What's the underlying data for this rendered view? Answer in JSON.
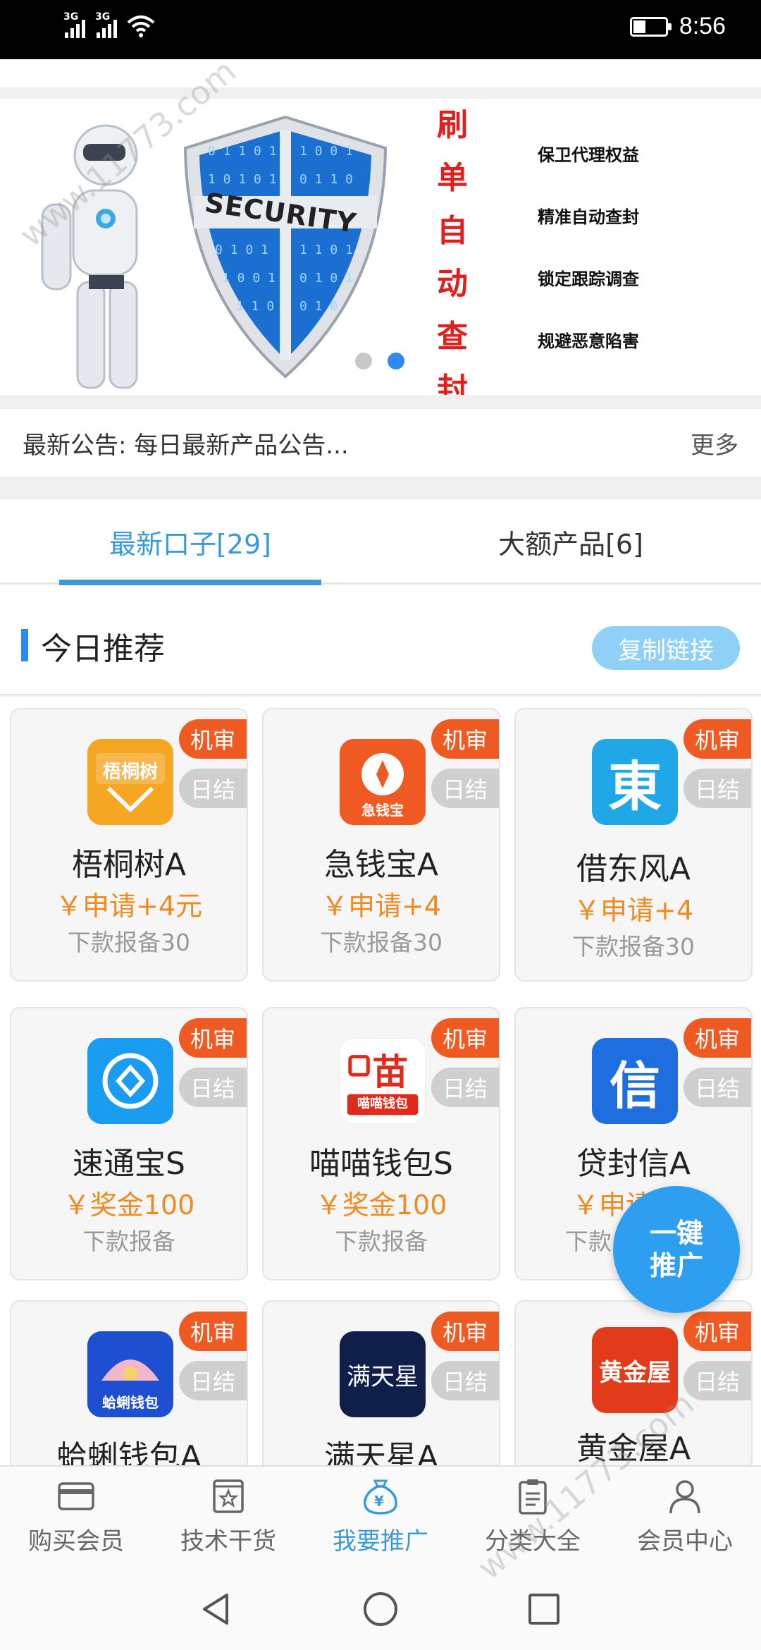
{
  "status_bar": {
    "network_1": "3G",
    "network_2": "3G",
    "time": "8:56",
    "battery_level": 0.4
  },
  "banner": {
    "shield_text": "SECURITY",
    "title_chars": [
      "刷",
      "单",
      "自",
      "动",
      "查",
      "封"
    ],
    "features": [
      "保卫代理权益",
      "精准自动查封",
      "锁定跟踪调查",
      "规避恶意陷害"
    ],
    "dots_active": 1
  },
  "notice": {
    "text": "最新公告: 每日最新产品公告...",
    "more": "更多"
  },
  "tabs": [
    {
      "label": "最新口子[29]",
      "active": true
    },
    {
      "label": "大额产品[6]",
      "active": false
    }
  ],
  "section": {
    "title": "今日推荐",
    "copy_button": "复制链接"
  },
  "cards": [
    {
      "name": "梧桐树A",
      "price": "￥申请+4元",
      "desc": "下款报备30",
      "badge1": "机审",
      "badge2": "日结",
      "logo_text": "梧桐树",
      "logo_color": "#f59a1e"
    },
    {
      "name": "急钱宝A",
      "price": "￥申请+4",
      "desc": "下款报备30",
      "badge1": "机审",
      "badge2": "日结",
      "logo_text": "急钱宝",
      "logo_color": "#ef5a22"
    },
    {
      "name": "借东风A",
      "price": "￥申请+4",
      "desc": "下款报备30",
      "badge1": "机审",
      "badge2": "日结",
      "logo_text": "東",
      "logo_color": "#1fa7e8"
    },
    {
      "name": "速通宝S",
      "price": "￥奖金100",
      "desc": "下款报备",
      "badge1": "机审",
      "badge2": "日结",
      "logo_text": "",
      "logo_color": "#1a9df0"
    },
    {
      "name": "喵喵钱包S",
      "price": "￥奖金100",
      "desc": "下款报备",
      "badge1": "机审",
      "badge2": "日结",
      "logo_text": "喵喵钱包",
      "logo_color": "#ffffff"
    },
    {
      "name": "贷封信A",
      "price": "￥申请",
      "desc": "下款",
      "badge1": "机审",
      "badge2": "日结",
      "logo_text": "信",
      "logo_color": "#1f6ee0"
    },
    {
      "name": "蛤蜊钱包A",
      "price": "",
      "desc": "",
      "badge1": "机审",
      "badge2": "日结",
      "logo_text": "蛤蜊钱包",
      "logo_color": "#1e4fd1"
    },
    {
      "name": "满天星A",
      "price": "",
      "desc": "",
      "badge1": "机审",
      "badge2": "日结",
      "logo_text": "满天星",
      "logo_color": "#0f1f4a"
    },
    {
      "name": "黄金屋A",
      "price": "",
      "desc": "",
      "badge1": "机审",
      "badge2": "日结",
      "logo_text": "黄金屋",
      "logo_color": "#e23b1c"
    }
  ],
  "fab": {
    "line1": "一键",
    "line2": "推广"
  },
  "bottom_nav": [
    {
      "label": "购买会员",
      "icon": "card-icon",
      "active": false
    },
    {
      "label": "技术干货",
      "icon": "star-box-icon",
      "active": false
    },
    {
      "label": "我要推广",
      "icon": "money-bag-icon",
      "active": true
    },
    {
      "label": "分类大全",
      "icon": "clipboard-icon",
      "active": false
    },
    {
      "label": "会员中心",
      "icon": "user-icon",
      "active": false
    }
  ],
  "watermark": "www.11773.com",
  "colors": {
    "accent": "#3a9ad9",
    "badge_orange": "#ef5a22",
    "price_orange": "#f08a1e",
    "banner_red": "#e0201e"
  }
}
